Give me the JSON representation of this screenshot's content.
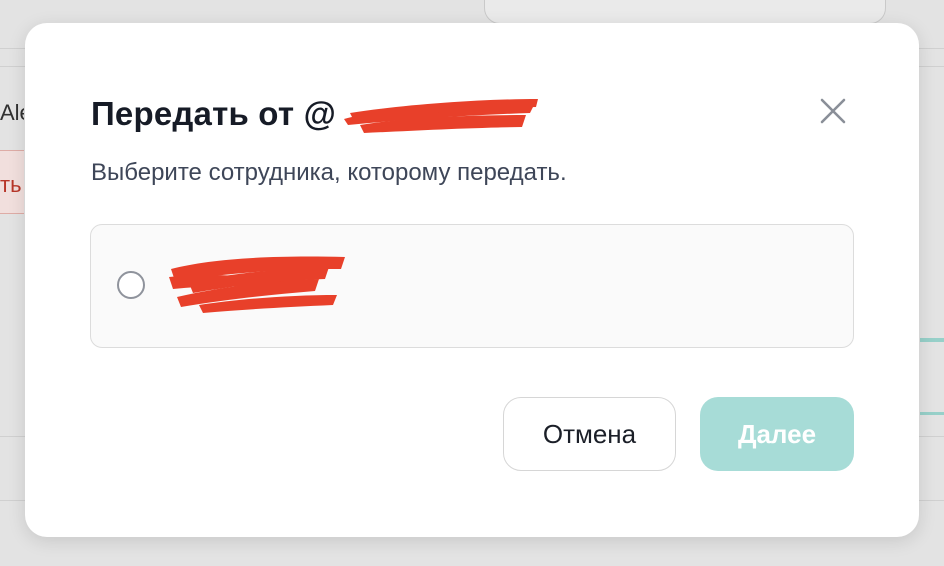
{
  "background": {
    "left_text": "Ale",
    "alert_text": "ть"
  },
  "modal": {
    "title": "Передать от @",
    "subtitle": "Выберите сотрудника, которому передать.",
    "close_icon": "close-icon",
    "employee": {
      "handle": "@",
      "role": "",
      "selected": false
    },
    "buttons": {
      "cancel_label": "Отмена",
      "next_label": "Далее"
    }
  },
  "colors": {
    "accent_disabled": "#a7dcd7",
    "title_text": "#161b26",
    "subtitle_text": "#3e4658",
    "redaction": "#e8402a"
  }
}
